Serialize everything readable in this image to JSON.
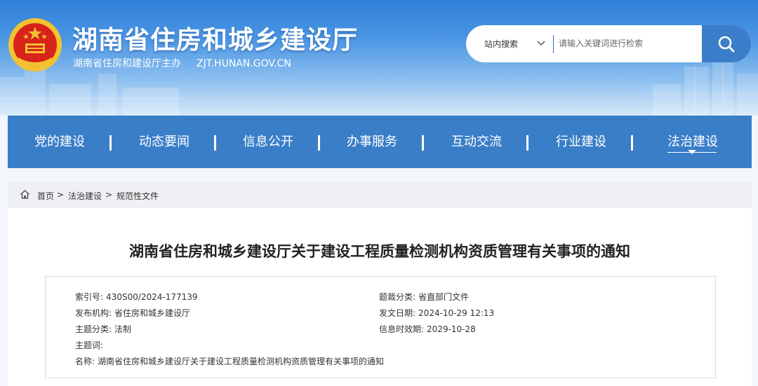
{
  "site": {
    "title": "湖南省住房和城乡建设厅",
    "subtitle": "湖南省住房和建设厅主办",
    "domain": "ZJT.HUNAN.GOV.CN"
  },
  "search": {
    "scope_label": "站内搜索",
    "placeholder": "请输入关键词进行检索"
  },
  "nav": {
    "items": [
      "党的建设",
      "动态要闻",
      "信息公开",
      "办事服务",
      "互动交流",
      "行业建设",
      "法治建设"
    ],
    "active": "法治建设"
  },
  "breadcrumb": {
    "items": [
      "首页",
      "法治建设",
      "规范性文件"
    ],
    "separator": ">"
  },
  "article": {
    "title": "湖南省住房和城乡建设厅关于建设工程质量检测机构资质管理有关事项的通知"
  },
  "meta": {
    "index_no": {
      "label": "索引号:",
      "value": "430S00/2024-177139"
    },
    "genre": {
      "label": "题裁分类:",
      "value": "省直部门文件"
    },
    "publisher": {
      "label": "发布机构:",
      "value": "省住房和城乡建设厅"
    },
    "issue_date": {
      "label": "发文日期:",
      "value": "2024-10-29 12:13"
    },
    "topic": {
      "label": "主题分类:",
      "value": "法制"
    },
    "expiry": {
      "label": "信息时效期:",
      "value": "2029-10-28"
    },
    "keywords": {
      "label": "主题词:",
      "value": ""
    },
    "name": {
      "label": "名称:",
      "value": "湖南省住房和城乡建设厅关于建设工程质量检测机构资质管理有关事项的通知"
    }
  },
  "colors": {
    "header_blue": "#2f7fd8",
    "nav_blue": "#3a7ec8",
    "search_button": "#3b7dc9",
    "emblem_red": "#d8231b",
    "emblem_gold": "#f2c230"
  },
  "icons": {
    "emblem": "national-emblem-icon",
    "search": "search-icon",
    "dropdown": "chevron-down-icon",
    "home": "home-icon",
    "active_nav": "caret-down-icon"
  }
}
